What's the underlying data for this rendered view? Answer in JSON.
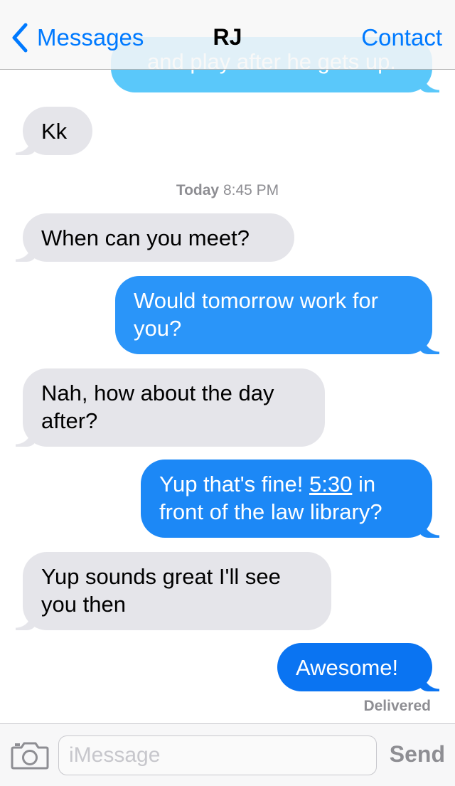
{
  "nav": {
    "back_label": "Messages",
    "title": "RJ",
    "contact_label": "Contact"
  },
  "thread": {
    "timestamp_day": "Today",
    "timestamp_time": "8:45 PM",
    "status": "Delivered",
    "messages": [
      {
        "from": "me",
        "text": "and play after he gets up."
      },
      {
        "from": "them",
        "text": "Kk"
      },
      {
        "from": "them",
        "text": "When can you meet?"
      },
      {
        "from": "me",
        "text": "Would tomorrow work for you?"
      },
      {
        "from": "them",
        "text": "Nah, how about the day after?"
      },
      {
        "from": "me",
        "text_before": "Yup that's fine! ",
        "link": "5:30",
        "text_after": " in front of the law library?"
      },
      {
        "from": "them",
        "text": "Yup sounds great I'll see you then"
      },
      {
        "from": "me",
        "text": "Awesome!"
      }
    ]
  },
  "input": {
    "placeholder": "iMessage",
    "value": "",
    "send_label": "Send",
    "camera_icon": "camera-icon"
  },
  "colors": {
    "accent": "#007aff",
    "incoming_bubble": "#e5e5ea",
    "outgoing_bubble": "#1c88f6",
    "meta_text": "#8e8e93"
  }
}
